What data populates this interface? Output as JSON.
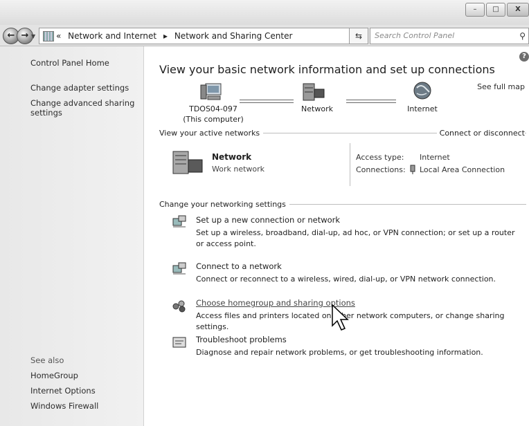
{
  "window": {
    "controls": {
      "minimize": "–",
      "maximize": "□",
      "close": "X"
    }
  },
  "nav": {
    "back_icon": "back-arrow-icon",
    "forward_icon": "forward-arrow-icon",
    "breadcrumbs": [
      "«",
      "Network and Internet",
      "▸",
      "Network and Sharing Center"
    ],
    "search_placeholder": "Search Control Panel"
  },
  "sidebar": {
    "items": [
      "Control Panel Home",
      "Change adapter settings",
      "Change advanced sharing",
      "settings"
    ],
    "see_also_title": "See also",
    "see_also": [
      "HomeGroup",
      "Internet Options",
      "Windows Firewall"
    ]
  },
  "main": {
    "title": "View your basic network information and set up connections",
    "see_full_map": "See full map",
    "map": {
      "computer_name": "TDOS04-097",
      "computer_sub": "(This computer)",
      "network": "Network",
      "internet": "Internet"
    },
    "active_networks": {
      "header": "View your active networks",
      "connect_link": "Connect or disconnect",
      "network_name": "Network",
      "network_type": "Work network",
      "access_type_label": "Access type:",
      "access_type_value": "Internet",
      "connections_label": "Connections:",
      "connections_value": "Local Area Connection"
    },
    "settings": {
      "header": "Change your networking settings",
      "tasks": [
        {
          "title": "Set up a new connection or network",
          "desc": "Set up a wireless, broadband, dial-up, ad hoc, or VPN connection; or set up a router or access point."
        },
        {
          "title": "Connect to a network",
          "desc": "Connect or reconnect to a wireless, wired, dial-up, or VPN network connection."
        },
        {
          "title": "Choose homegroup and sharing options",
          "desc": "Access files and printers located on other network computers, or change sharing settings."
        },
        {
          "title": "Troubleshoot problems",
          "desc": "Diagnose and repair network problems, or get troubleshooting information."
        }
      ]
    }
  }
}
